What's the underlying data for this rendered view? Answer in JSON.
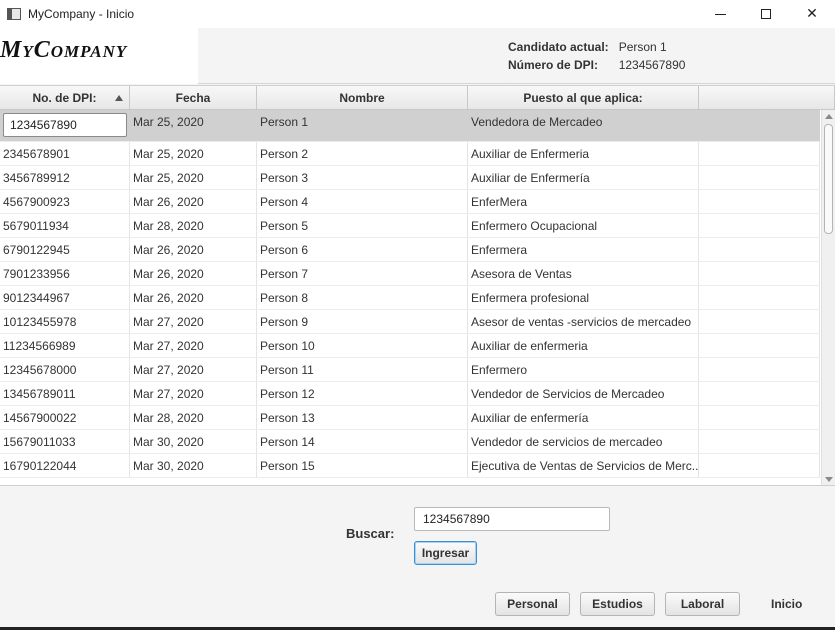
{
  "window": {
    "title": "MyCompany - Inicio",
    "minimize": "—",
    "close": "✕"
  },
  "header": {
    "logo": "MyCompany",
    "candidate_label": "Candidato actual:",
    "candidate_value": "Person 1",
    "dpi_label": "Número de DPI:",
    "dpi_value": "1234567890"
  },
  "table": {
    "columns": [
      "No. de DPI:",
      "Fecha",
      "Nombre",
      "Puesto al que aplica:",
      ""
    ],
    "sort_column": "No. de DPI:",
    "sort_direction": "ascending",
    "editing_value": "1234567890",
    "rows": [
      {
        "dpi": "1234567890",
        "fecha": "Mar 25, 2020",
        "nombre": "Person 1",
        "puesto": "Vendedora de Mercadeo"
      },
      {
        "dpi": "2345678901",
        "fecha": "Mar 25, 2020",
        "nombre": "Person 2",
        "puesto": "Auxiliar de Enfermeria"
      },
      {
        "dpi": "3456789912",
        "fecha": "Mar 25, 2020",
        "nombre": "Person 3",
        "puesto": "Auxiliar de Enfermería"
      },
      {
        "dpi": "4567900923",
        "fecha": "Mar 26, 2020",
        "nombre": "Person 4",
        "puesto": "EnferMera"
      },
      {
        "dpi": "5679011934",
        "fecha": "Mar 28, 2020",
        "nombre": "Person 5",
        "puesto": "Enfermero Ocupacional"
      },
      {
        "dpi": "6790122945",
        "fecha": "Mar 26, 2020",
        "nombre": "Person 6",
        "puesto": "Enfermera"
      },
      {
        "dpi": "7901233956",
        "fecha": "Mar 26, 2020",
        "nombre": "Person 7",
        "puesto": "Asesora de Ventas"
      },
      {
        "dpi": "9012344967",
        "fecha": "Mar 26, 2020",
        "nombre": "Person 8",
        "puesto": "Enfermera profesional"
      },
      {
        "dpi": "10123455978",
        "fecha": "Mar 27, 2020",
        "nombre": "Person 9",
        "puesto": "Asesor de ventas -servicios de mercadeo"
      },
      {
        "dpi": "11234566989",
        "fecha": "Mar 27, 2020",
        "nombre": "Person 10",
        "puesto": "Auxiliar de enfermeria"
      },
      {
        "dpi": "12345678000",
        "fecha": "Mar 27, 2020",
        "nombre": "Person 11",
        "puesto": "Enfermero"
      },
      {
        "dpi": "13456789011",
        "fecha": "Mar 27, 2020",
        "nombre": "Person 12",
        "puesto": "Vendedor de Servicios de Mercadeo"
      },
      {
        "dpi": "14567900022",
        "fecha": "Mar 28, 2020",
        "nombre": "Person 13",
        "puesto": "Auxiliar de enfermería"
      },
      {
        "dpi": "15679011033",
        "fecha": "Mar 30, 2020",
        "nombre": "Person 14",
        "puesto": "Vendedor de servicios de mercadeo"
      },
      {
        "dpi": "16790122044",
        "fecha": "Mar 30, 2020",
        "nombre": "Person 15",
        "puesto": "Ejecutiva de Ventas de Servicios de Merc..."
      }
    ]
  },
  "search": {
    "label": "Buscar:",
    "value": "1234567890",
    "submit_label": "Ingresar"
  },
  "nav": {
    "personal": "Personal",
    "estudios": "Estudios",
    "laboral": "Laboral",
    "current": "Inicio"
  }
}
